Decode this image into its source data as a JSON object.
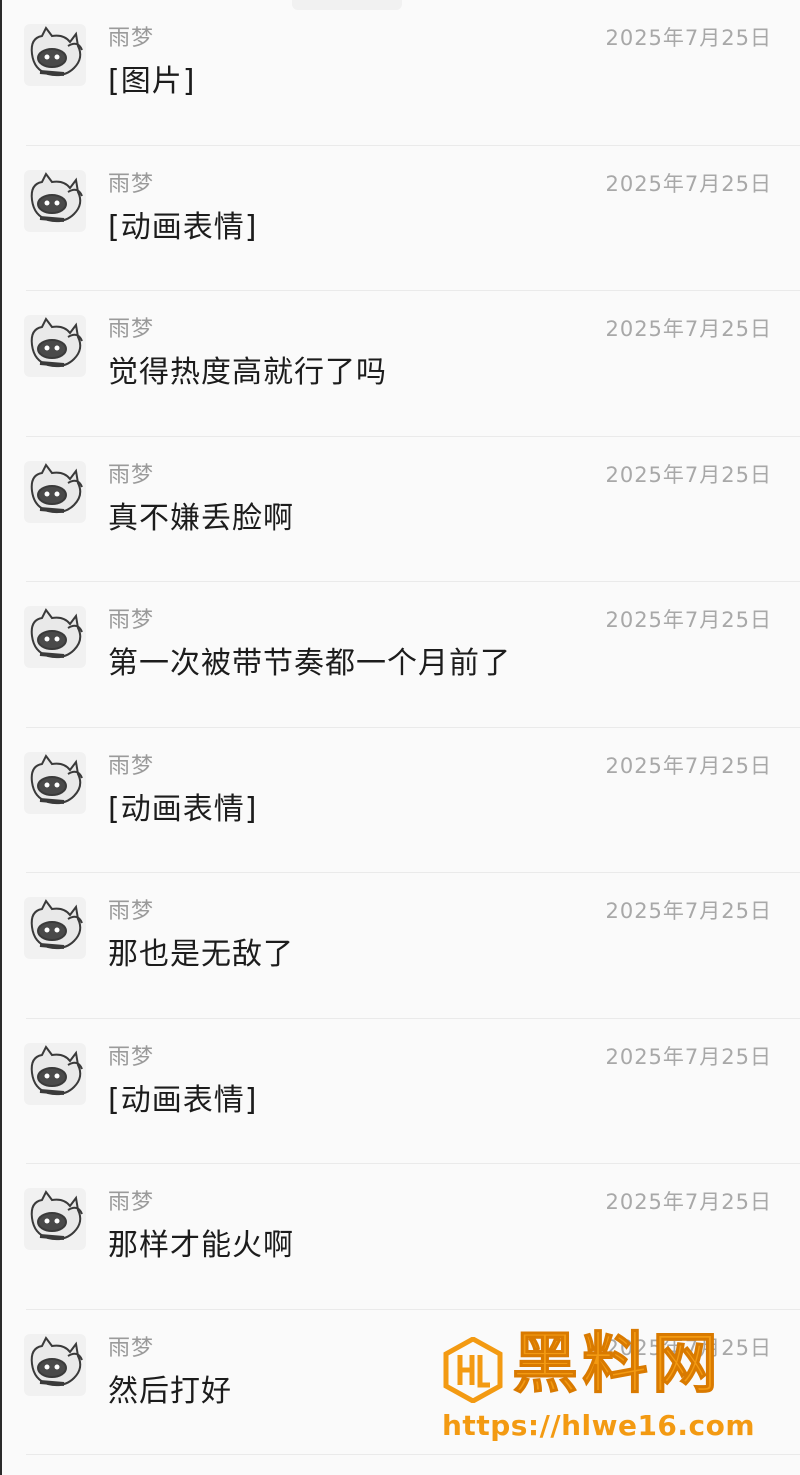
{
  "messages": [
    {
      "sender": "雨梦",
      "time": "2025年7月25日",
      "text": "[图片]"
    },
    {
      "sender": "雨梦",
      "time": "2025年7月25日",
      "text": "[动画表情]"
    },
    {
      "sender": "雨梦",
      "time": "2025年7月25日",
      "text": "觉得热度高就行了吗"
    },
    {
      "sender": "雨梦",
      "time": "2025年7月25日",
      "text": "真不嫌丢脸啊"
    },
    {
      "sender": "雨梦",
      "time": "2025年7月25日",
      "text": "第一次被带节奏都一个月前了"
    },
    {
      "sender": "雨梦",
      "time": "2025年7月25日",
      "text": "[动画表情]"
    },
    {
      "sender": "雨梦",
      "time": "2025年7月25日",
      "text": "那也是无敌了"
    },
    {
      "sender": "雨梦",
      "time": "2025年7月25日",
      "text": "[动画表情]"
    },
    {
      "sender": "雨梦",
      "time": "2025年7月25日",
      "text": "那样才能火啊"
    },
    {
      "sender": "雨梦",
      "time": "2025年7月25日",
      "text": "然后打好"
    }
  ],
  "watermark": {
    "title": "黑料网",
    "url": "https://hlwe16.com",
    "color": "#f39a12"
  },
  "icons": {
    "avatar": "cartoon-cat-avatar-icon",
    "watermark_logo": "hl-logo-icon"
  }
}
